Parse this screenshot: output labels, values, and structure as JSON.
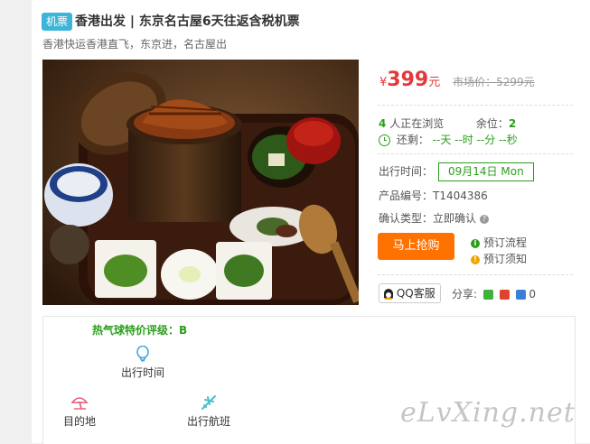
{
  "product": {
    "tag": "机票",
    "title": "香港出发 | 东京名古屋6天往返含税机票",
    "subtitle": "香港快运香港直飞，东京进，名古屋出",
    "image_icon": "hitsumabushi-meal-photo"
  },
  "pricing": {
    "currency_symbol": "¥",
    "price": "399",
    "unit": "元",
    "market_price": "市场价：5299元"
  },
  "status": {
    "viewers_count": "4",
    "viewers_text": "人正在浏览",
    "remaining_label": "余位：",
    "remaining_count": "2",
    "countdown_label": "还剩：",
    "countdown_text": "--天 --时 --分 --秒"
  },
  "details": {
    "depart_label": "出行时间：",
    "depart_value": "09月14日 Mon",
    "code_label": "产品编号：",
    "code_value": "T1404386",
    "confirm_label": "确认类型：",
    "confirm_value": "立即确认"
  },
  "actions": {
    "buy_label": "马上抢购",
    "flow_label": "预订流程",
    "notice_label": "预订须知",
    "qq_label": "QQ客服",
    "share_label": "分享:",
    "share_count": "0"
  },
  "features": {
    "rating": "热气球特价评级：B",
    "depart_time": "出行时间",
    "destination": "目的地",
    "flight": "出行航班"
  },
  "watermark": "eLvXing.net",
  "colors": {
    "accent_red": "#e4393c",
    "accent_green": "#2a9e1a",
    "buy_orange": "#ff7200",
    "tag_blue": "#3cb5d8"
  }
}
